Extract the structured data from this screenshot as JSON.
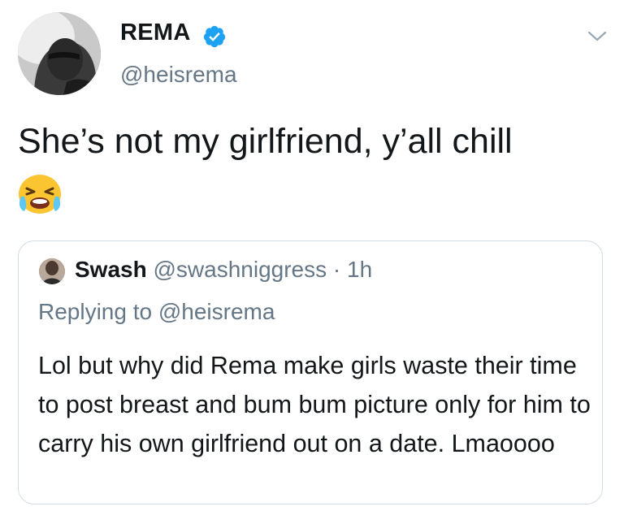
{
  "author": {
    "name": "REMA",
    "handle": "@heisrema",
    "verified": true
  },
  "tweet": {
    "text": "She’s not my girlfriend, y’all chill",
    "emoji": "loudly-crying-face-emoji"
  },
  "quoted_tweet": {
    "name": "Swash",
    "handle": "@swashniggress",
    "separator": "·",
    "time": "1h",
    "replying_to": "Replying to @heisrema",
    "text": "Lol but why did Rema make girls waste their time to post breast and bum bum picture only for him to carry his own girlfriend out on a date. Lmaoooo"
  },
  "colors": {
    "verified": "#1da1f2",
    "secondary_text": "#657786",
    "primary_text": "#14171a",
    "border": "#d4dbe1"
  }
}
